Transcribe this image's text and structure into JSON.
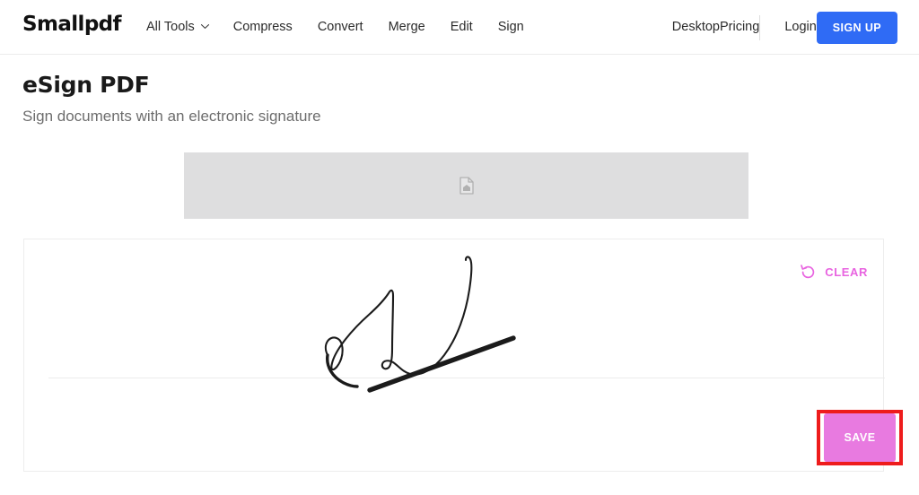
{
  "header": {
    "logo": "Smallpdf",
    "nav_left": [
      {
        "label": "All Tools",
        "icon": "chevron-down-icon",
        "has_chevron": true
      },
      {
        "label": "Compress",
        "has_chevron": false
      },
      {
        "label": "Convert",
        "has_chevron": false
      },
      {
        "label": "Merge",
        "has_chevron": false
      },
      {
        "label": "Edit",
        "has_chevron": false
      },
      {
        "label": "Sign",
        "has_chevron": false
      }
    ],
    "nav_right": {
      "desktop": "Desktop",
      "pricing": "Pricing",
      "login": "Login",
      "signup": "SIGN UP"
    },
    "signup_color": "#2f6bf5"
  },
  "page": {
    "title": "eSign PDF",
    "subtitle": "Sign documents with an electronic signature"
  },
  "document_preview": {
    "icon": "document-page-icon",
    "background_color": "#dededf"
  },
  "signature_card": {
    "clear": {
      "label": "CLEAR",
      "icon": "undo-arrow-icon",
      "color": "#e863e0"
    },
    "baseline_color": "#ebebeb",
    "stroke_color": "#1b1b1b"
  },
  "save_button": {
    "label": "SAVE",
    "fill_color": "#e87ae0",
    "text_color": "#ffffff",
    "annotation_color": "#ee1c1c"
  }
}
